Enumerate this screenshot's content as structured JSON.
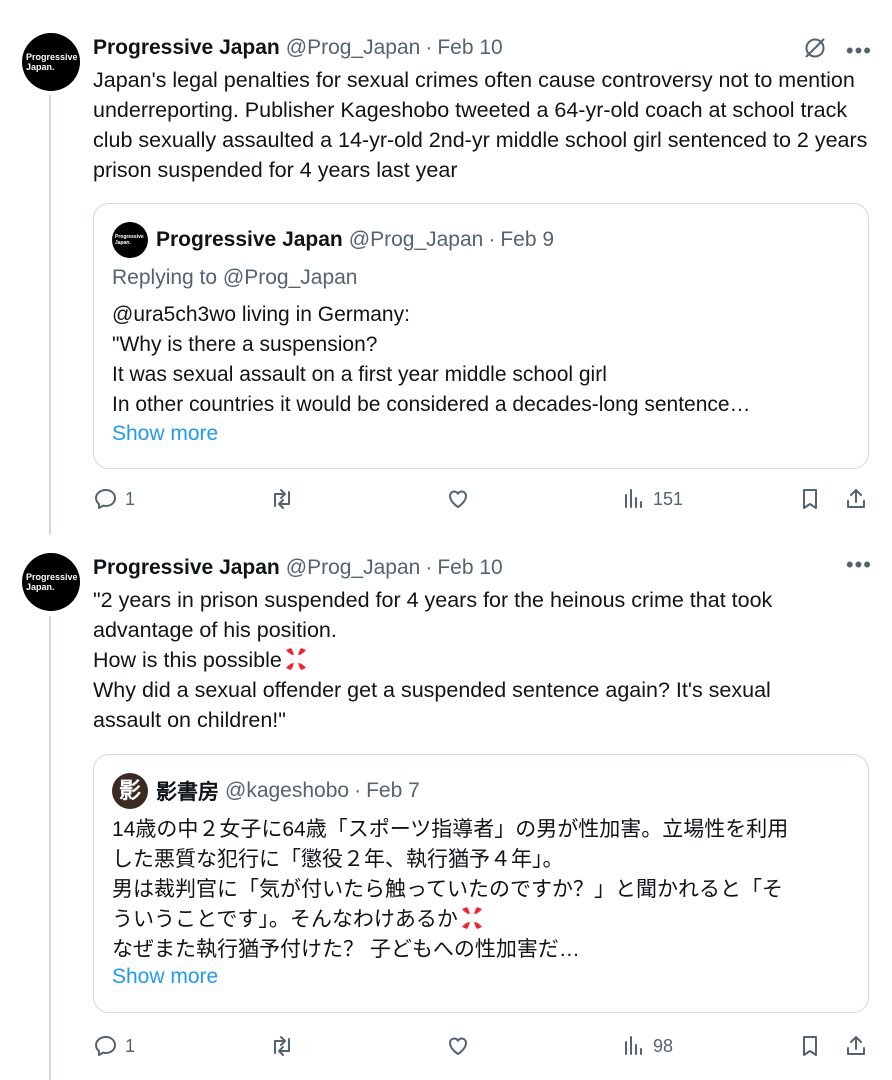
{
  "posts": [
    {
      "avatar_text": [
        "Progressive",
        "Japan."
      ],
      "name": "Progressive Japan",
      "handle": "@Prog_Japan",
      "separator": "·",
      "date": "Feb 10",
      "text": "Japan's legal penalties for sexual crimes often cause controversy not to mention underreporting. Publisher Kageshobo tweeted a 64-yr-old coach at school track club sexually assaulted a 14-yr-old 2nd-yr middle school girl sentenced to 2 years prison suspended for 4 years last year",
      "quote": {
        "avatar_text": [
          "Progressive",
          "Japan."
        ],
        "name": "Progressive Japan",
        "handle": "@Prog_Japan",
        "separator": "·",
        "date": "Feb 9",
        "replying_label": "Replying to",
        "replying_to": "@Prog_Japan",
        "lines": [
          "@ura5ch3wo living in Germany:",
          "\"Why is there a suspension?",
          "It was sexual assault on a first year middle school girl",
          "In other countries it would be considered a decades-long sentence…"
        ],
        "show_more": "Show more"
      },
      "actions": {
        "replies": "1",
        "reposts": "",
        "likes": "",
        "views": "151"
      }
    },
    {
      "avatar_text": [
        "Progressive",
        "Japan."
      ],
      "name": "Progressive Japan",
      "handle": "@Prog_Japan",
      "separator": "·",
      "date": "Feb 10",
      "lines": [
        "\"2 years in prison suspended for 4 years for the heinous crime that took",
        "advantage of his position.",
        "How is this possible",
        "Why did a sexual offender get a suspended sentence again? It's sexual",
        "assault on children!\""
      ],
      "quote": {
        "avatar_char": "影",
        "name": "影書房",
        "handle": "@kageshobo",
        "separator": "·",
        "date": "Feb 7",
        "lines": [
          "14歳の中２女子に64歳「スポーツ指導者」の男が性加害。立場性を利用",
          "した悪質な犯行に「懲役２年、執行猶予４年」。",
          "男は裁判官に「気が付いたら触っていたのですか？」と聞かれると「そ",
          "ういうことです」。そんなわけあるか",
          "なぜまた執行猶予付けた？ 子どもへの性加害だ…"
        ],
        "show_more": "Show more"
      },
      "actions": {
        "replies": "1",
        "reposts": "",
        "likes": "",
        "views": "98"
      }
    }
  ],
  "icons": {
    "grok": "grok-icon",
    "more": "more-icon",
    "reply": "reply-icon",
    "repost": "repost-icon",
    "like": "like-icon",
    "views": "views-icon",
    "bookmark": "bookmark-icon",
    "share": "share-icon",
    "anger": "anger-emoji-icon"
  },
  "colors": {
    "text": "#0f1419",
    "secondary": "#536471",
    "link": "#1d9bf0",
    "border": "#cfd9de",
    "anger": "#f4212e"
  }
}
